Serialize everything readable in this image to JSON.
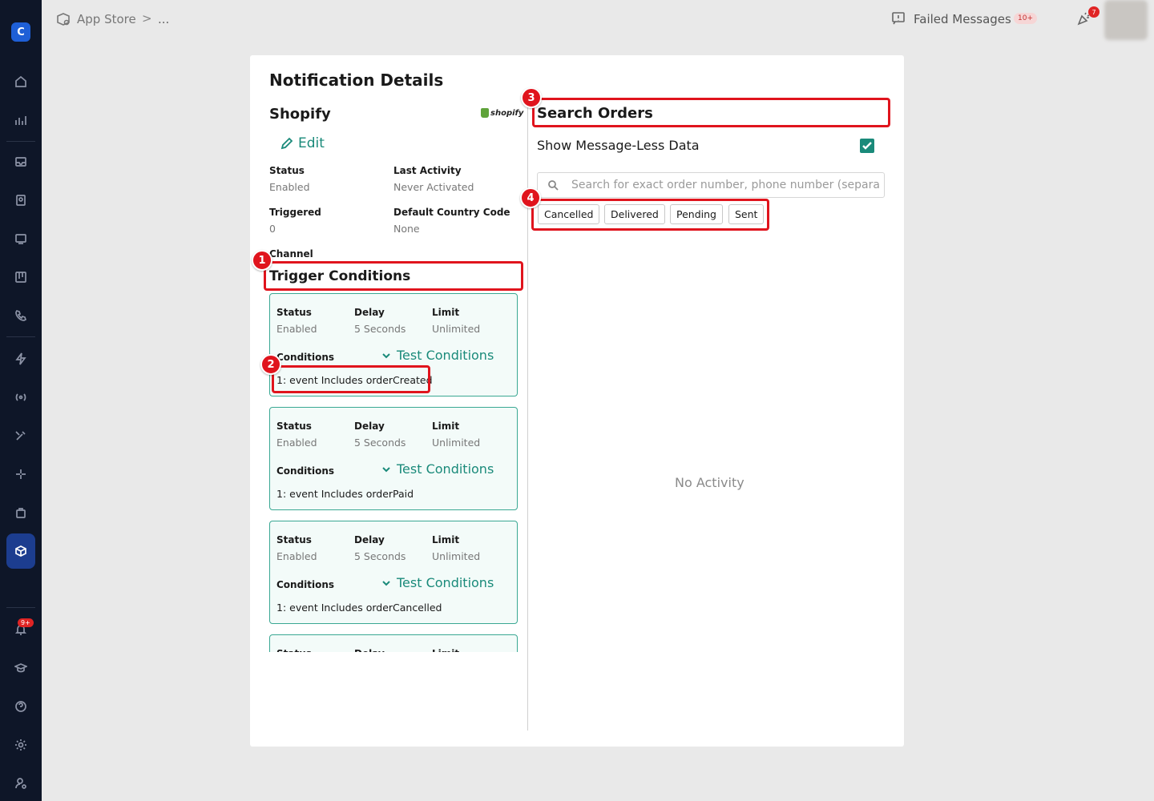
{
  "topbar": {
    "breadcrumb_root": "App Store",
    "breadcrumb_sep": ">",
    "breadcrumb_more": "...",
    "failed_messages_label": "Failed Messages",
    "failed_messages_count": "10+",
    "announcement_count": "7"
  },
  "sidebar": {
    "logo_glyph": "C",
    "notifications_badge": "9+",
    "icons": [
      "home-icon",
      "analytics-icon",
      "inbox-icon",
      "contacts-icon",
      "broadcast-icon",
      "board-icon",
      "phone-icon",
      "automation-icon",
      "signal-icon",
      "tools-icon",
      "ai-sparkle-icon",
      "bag-icon",
      "app-store-icon",
      "bell-icon",
      "academy-icon",
      "help-icon",
      "settings-icon",
      "profile-icon"
    ]
  },
  "modal": {
    "title": "Notification Details",
    "integration": {
      "name": "Shopify",
      "logo_text": "shopify",
      "edit_label": "Edit",
      "status_label": "Status",
      "status_value": "Enabled",
      "last_activity_label": "Last Activity",
      "last_activity_value": "Never Activated",
      "triggered_label": "Triggered",
      "triggered_value": "0",
      "country_code_label": "Default Country Code",
      "country_code_value": "None",
      "channel_label": "Channel"
    },
    "trigger_conditions": {
      "title": "Trigger Conditions",
      "status_label": "Status",
      "delay_label": "Delay",
      "limit_label": "Limit",
      "conditions_label": "Conditions",
      "test_label": "Test Conditions",
      "cards": [
        {
          "status": "Enabled",
          "delay": "5 Seconds",
          "limit": "Unlimited",
          "rule": "1: event Includes orderCreated"
        },
        {
          "status": "Enabled",
          "delay": "5 Seconds",
          "limit": "Unlimited",
          "rule": "1: event Includes orderPaid"
        },
        {
          "status": "Enabled",
          "delay": "5 Seconds",
          "limit": "Unlimited",
          "rule": "1: event Includes orderCancelled"
        }
      ]
    },
    "search_orders": {
      "title": "Search Orders",
      "toggle_label": "Show Message-Less Data",
      "toggle_checked": true,
      "search_placeholder": "Search for exact order number, phone number (separated by comma)",
      "filters": [
        "Cancelled",
        "Delivered",
        "Pending",
        "Sent"
      ],
      "empty_text": "No Activity"
    }
  },
  "annotations": [
    "1",
    "2",
    "3",
    "4"
  ],
  "colors": {
    "accent": "#1a8a7a",
    "sidebar_bg": "#0e1628",
    "highlight": "#e0141d",
    "card_border": "#3aa893"
  }
}
